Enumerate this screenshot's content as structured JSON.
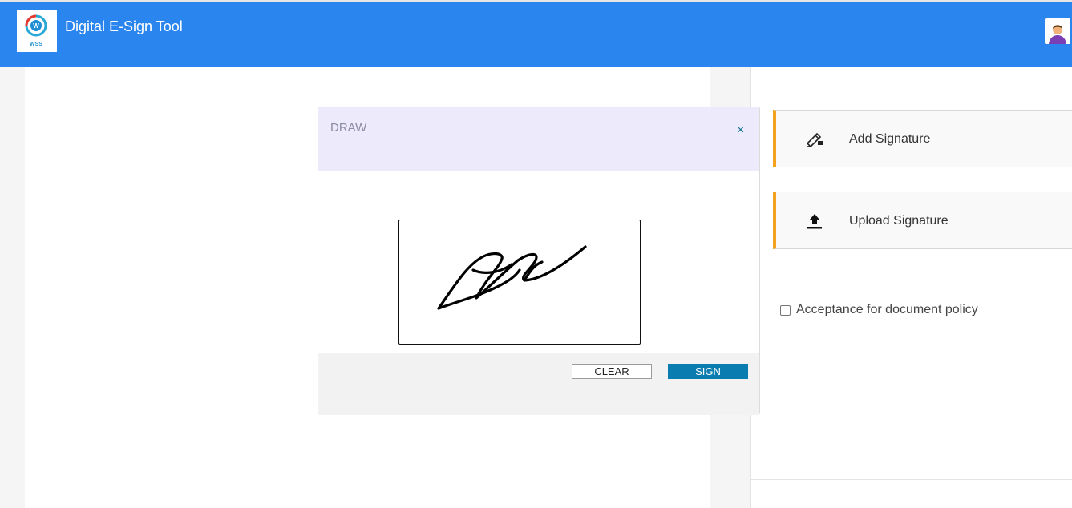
{
  "header": {
    "title": "Digital E-Sign Tool",
    "logo_text": "WSS",
    "logo_letter": "W",
    "accent_color": "#2b85ee"
  },
  "right_panel": {
    "actions": [
      {
        "label": "Add Signature",
        "icon": "pen-signature-icon"
      },
      {
        "label": "Upload Signature",
        "icon": "upload-icon"
      }
    ],
    "policy_label": "Acceptance for document policy",
    "card_accent_color": "#f4a21d"
  },
  "modal": {
    "title": "DRAW",
    "close_glyph": "×",
    "clear_label": "CLEAR",
    "sign_label": "SIGN",
    "sign_color": "#0a7cb0"
  }
}
